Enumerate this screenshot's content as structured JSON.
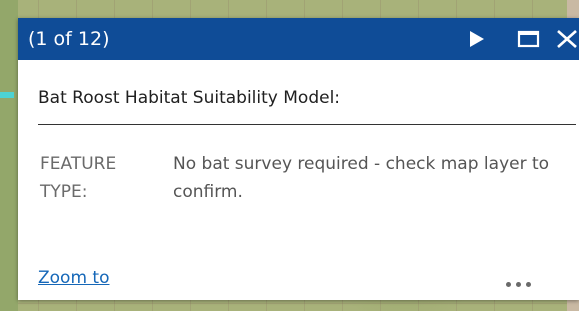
{
  "popup": {
    "header": {
      "page_indicator": "(1 of 12)",
      "next_icon": "play-triangle-icon",
      "maximize_icon": "maximize-square-icon",
      "close_icon": "close-x-icon",
      "background_color": "#0f4c97"
    },
    "title": "Bat Roost Habitat Suitability Model:",
    "fields": [
      {
        "label": "FEATURE TYPE:",
        "value": "No bat survey required - check map layer to confirm."
      }
    ],
    "footer": {
      "zoom_label": "Zoom to",
      "more_icon": "ellipsis-icon",
      "link_color": "#1567b8"
    }
  }
}
